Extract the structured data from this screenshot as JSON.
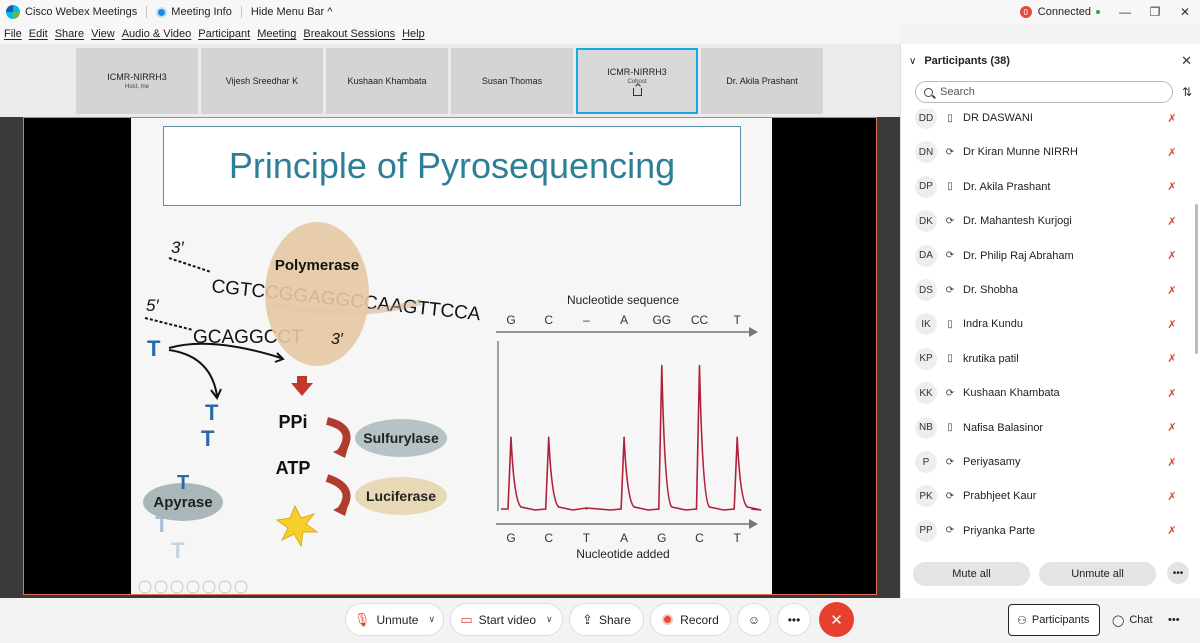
{
  "titlebar": {
    "app_name": "Cisco Webex Meetings",
    "meeting_info": "Meeting Info",
    "hide_menu": "Hide Menu Bar ^",
    "status_badge": "0",
    "status": "Connected"
  },
  "menu": [
    "File",
    "Edit",
    "Share",
    "View",
    "Audio & Video",
    "Participant",
    "Meeting",
    "Breakout Sessions",
    "Help"
  ],
  "filmstrip": [
    {
      "name": "ICMR-NIRRH3",
      "sub": "Host, me",
      "active": false
    },
    {
      "name": "Vijesh Sreedhar K",
      "sub": "",
      "active": false
    },
    {
      "name": "Kushaan Khambata",
      "sub": "",
      "active": false
    },
    {
      "name": "Susan Thomas",
      "sub": "",
      "active": false
    },
    {
      "name": "ICMR-NIRRH3",
      "sub": "Cohost",
      "active": true
    },
    {
      "name": "Dr. Akila Prashant",
      "sub": "",
      "active": false
    }
  ],
  "slide": {
    "title": "Principle of Pyrosequencing",
    "strand_top_label": "3′",
    "strand_mid_label": "5′",
    "top_strand": "CGTCCGGAGGCCAAGTTCCA",
    "bottom_strand": "GCAGGCCT",
    "polymerase": "Polymerase",
    "polymerase_end": "3′",
    "incoming_base": "T",
    "ppi": "PPi",
    "atp": "ATP",
    "sulfurylase": "Sulfurylase",
    "luciferase": "Luciferase",
    "apyrase": "Apyrase",
    "nucleotide_sequence_label": "Nucleotide sequence",
    "sequence_letters": [
      "G",
      "C",
      "–",
      "A",
      "GG",
      "CC",
      "T"
    ],
    "added_letters": [
      "G",
      "C",
      "T",
      "A",
      "G",
      "C",
      "T"
    ],
    "nucleotide_added_label": "Nucleotide added",
    "t_stack": [
      "T",
      "T",
      "T",
      "T",
      "T"
    ]
  },
  "chart_data": {
    "type": "line",
    "title": "Nucleotide sequence",
    "xlabel": "Nucleotide added",
    "categories": [
      "G",
      "C",
      "T",
      "A",
      "G",
      "C",
      "T"
    ],
    "series": [
      {
        "name": "",
        "values": [
          1,
          1,
          0,
          1,
          2,
          2,
          1
        ]
      }
    ],
    "ylim": [
      0,
      2.3
    ]
  },
  "panel": {
    "title": "Participants (38)",
    "search_placeholder": "Search",
    "participants": [
      {
        "initials": "DD",
        "name": "DR DASWANI",
        "device": "phone"
      },
      {
        "initials": "DN",
        "name": "Dr Kiran Munne NIRRH",
        "device": "sync"
      },
      {
        "initials": "DP",
        "name": "Dr. Akila Prashant",
        "device": "phone"
      },
      {
        "initials": "DK",
        "name": "Dr. Mahantesh Kurjogi",
        "device": "sync"
      },
      {
        "initials": "DA",
        "name": "Dr. Philip Raj Abraham",
        "device": "sync"
      },
      {
        "initials": "DS",
        "name": "Dr. Shobha",
        "device": "sync"
      },
      {
        "initials": "IK",
        "name": "Indra Kundu",
        "device": "phone"
      },
      {
        "initials": "KP",
        "name": "krutika patil",
        "device": "phone"
      },
      {
        "initials": "KK",
        "name": "Kushaan Khambata",
        "device": "sync"
      },
      {
        "initials": "NB",
        "name": "Nafisa Balasinor",
        "device": "phone"
      },
      {
        "initials": "P",
        "name": "Periyasamy",
        "device": "sync"
      },
      {
        "initials": "PK",
        "name": "Prabhjeet Kaur",
        "device": "sync"
      },
      {
        "initials": "PP",
        "name": "Priyanka Parte",
        "device": "sync"
      }
    ],
    "mute_all": "Mute all",
    "unmute_all": "Unmute all"
  },
  "controls": {
    "unmute": "Unmute",
    "start_video": "Start video",
    "share": "Share",
    "record": "Record",
    "participants": "Participants",
    "chat": "Chat"
  },
  "colors": {
    "accent": "#1aa7e6",
    "end": "#e7402f",
    "peak": "#b0203a",
    "title": "#2c7f96"
  }
}
